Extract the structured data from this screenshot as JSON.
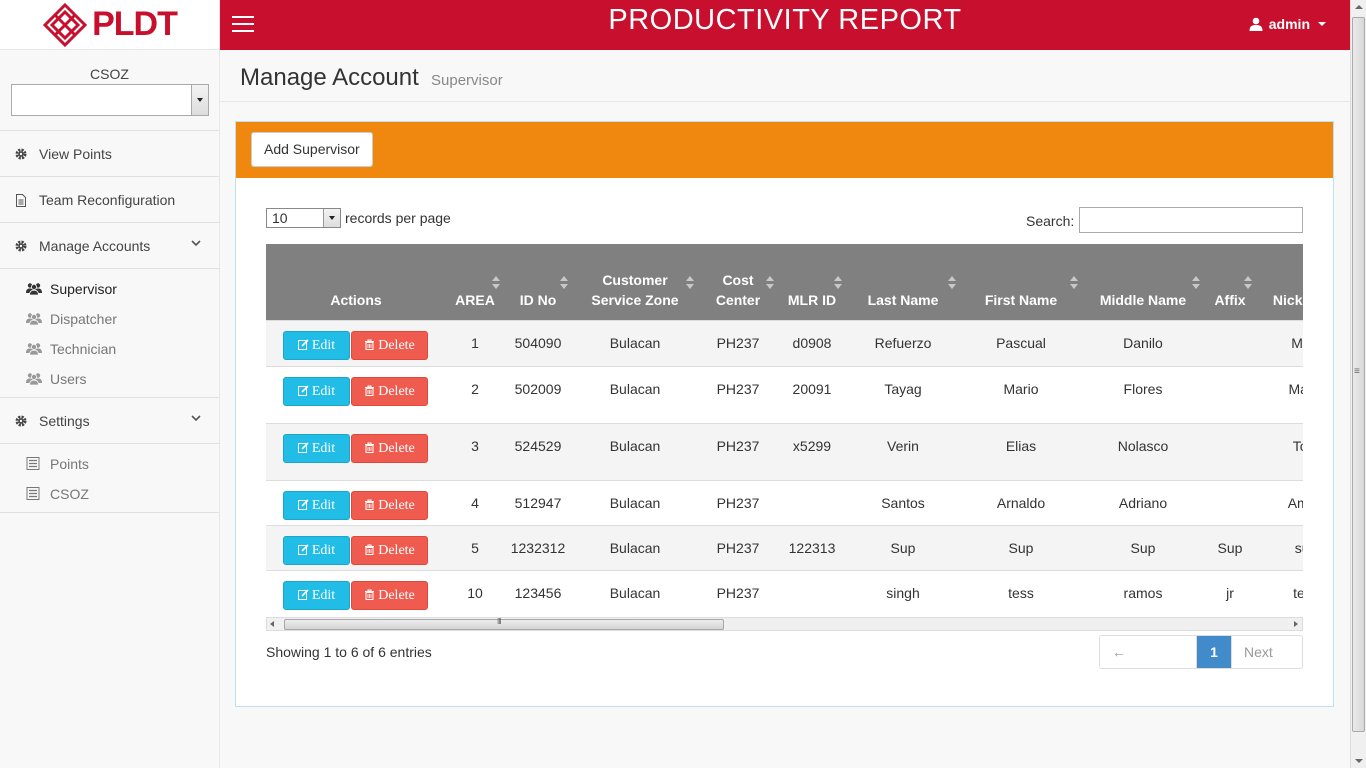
{
  "brand": {
    "logo_text": "PLDT",
    "primary_color": "#c8102e",
    "accent_color": "#f0880f"
  },
  "header": {
    "title": "PRODUCTIVITY REPORT",
    "user": "admin"
  },
  "sidebar": {
    "csoz_label": "CSOZ",
    "csoz_value": "",
    "items": [
      {
        "label": "View Points",
        "icon": "gear-icon"
      },
      {
        "label": "Team Reconfiguration",
        "icon": "document-icon"
      },
      {
        "label": "Manage Accounts",
        "icon": "gear-icon",
        "expanded": true,
        "children": [
          {
            "label": "Supervisor",
            "icon": "users-icon",
            "active": true
          },
          {
            "label": "Dispatcher",
            "icon": "users-icon"
          },
          {
            "label": "Technician",
            "icon": "users-icon"
          },
          {
            "label": "Users",
            "icon": "users-icon"
          }
        ]
      },
      {
        "label": "Settings",
        "icon": "gear-icon",
        "expanded": true,
        "children": [
          {
            "label": "Points",
            "icon": "list-icon"
          },
          {
            "label": "CSOZ",
            "icon": "list-icon"
          }
        ]
      }
    ]
  },
  "page": {
    "title": "Manage Account",
    "subtitle": "Supervisor"
  },
  "panel": {
    "add_button": "Add Supervisor"
  },
  "table_controls": {
    "page_length": "10",
    "page_length_suffix": "records per page",
    "search_label": "Search:",
    "search_value": ""
  },
  "table": {
    "columns": [
      "Actions",
      "AREA",
      "ID No",
      "Customer Service Zone",
      "Cost Center",
      "MLR ID",
      "Last Name",
      "First Name",
      "Middle Name",
      "Affix",
      "Nickname"
    ],
    "edit_label": "Edit",
    "delete_label": "Delete",
    "rows": [
      {
        "area": "1",
        "id_no": "504090",
        "zone": "Bulacan",
        "cost_center": "PH237",
        "mlr_id": "d0908",
        "last": "Refuerzo",
        "first": "Pascual",
        "middle": "Danilo",
        "affix": "",
        "nick": "Mike"
      },
      {
        "area": "2",
        "id_no": "502009",
        "zone": "Bulacan",
        "cost_center": "PH237",
        "mlr_id": "20091",
        "last": "Tayag",
        "first": "Mario",
        "middle": "Flores",
        "affix": "",
        "nick": "Mario"
      },
      {
        "area": "3",
        "id_no": "524529",
        "zone": "Bulacan",
        "cost_center": "PH237",
        "mlr_id": "x5299",
        "last": "Verin",
        "first": "Elias",
        "middle": "Nolasco",
        "affix": "",
        "nick": "Toto"
      },
      {
        "area": "4",
        "id_no": "512947",
        "zone": "Bulacan",
        "cost_center": "PH237",
        "mlr_id": "",
        "last": "Santos",
        "first": "Arnaldo",
        "middle": "Adriano",
        "affix": "",
        "nick": "Amba"
      },
      {
        "area": "5",
        "id_no": "1232312",
        "zone": "Bulacan",
        "cost_center": "PH237",
        "mlr_id": "122313",
        "last": "Sup",
        "first": "Sup",
        "middle": "Sup",
        "affix": "Sup",
        "nick": "sup"
      },
      {
        "area": "10",
        "id_no": "123456",
        "zone": "Bulacan",
        "cost_center": "PH237",
        "mlr_id": "",
        "last": "singh",
        "first": "tess",
        "middle": "ramos",
        "affix": "jr",
        "nick": "tess"
      }
    ]
  },
  "footer": {
    "info": "Showing 1 to 6 of 6 entries",
    "prev": "← Previous",
    "current_page": "1",
    "next": "Next →"
  }
}
